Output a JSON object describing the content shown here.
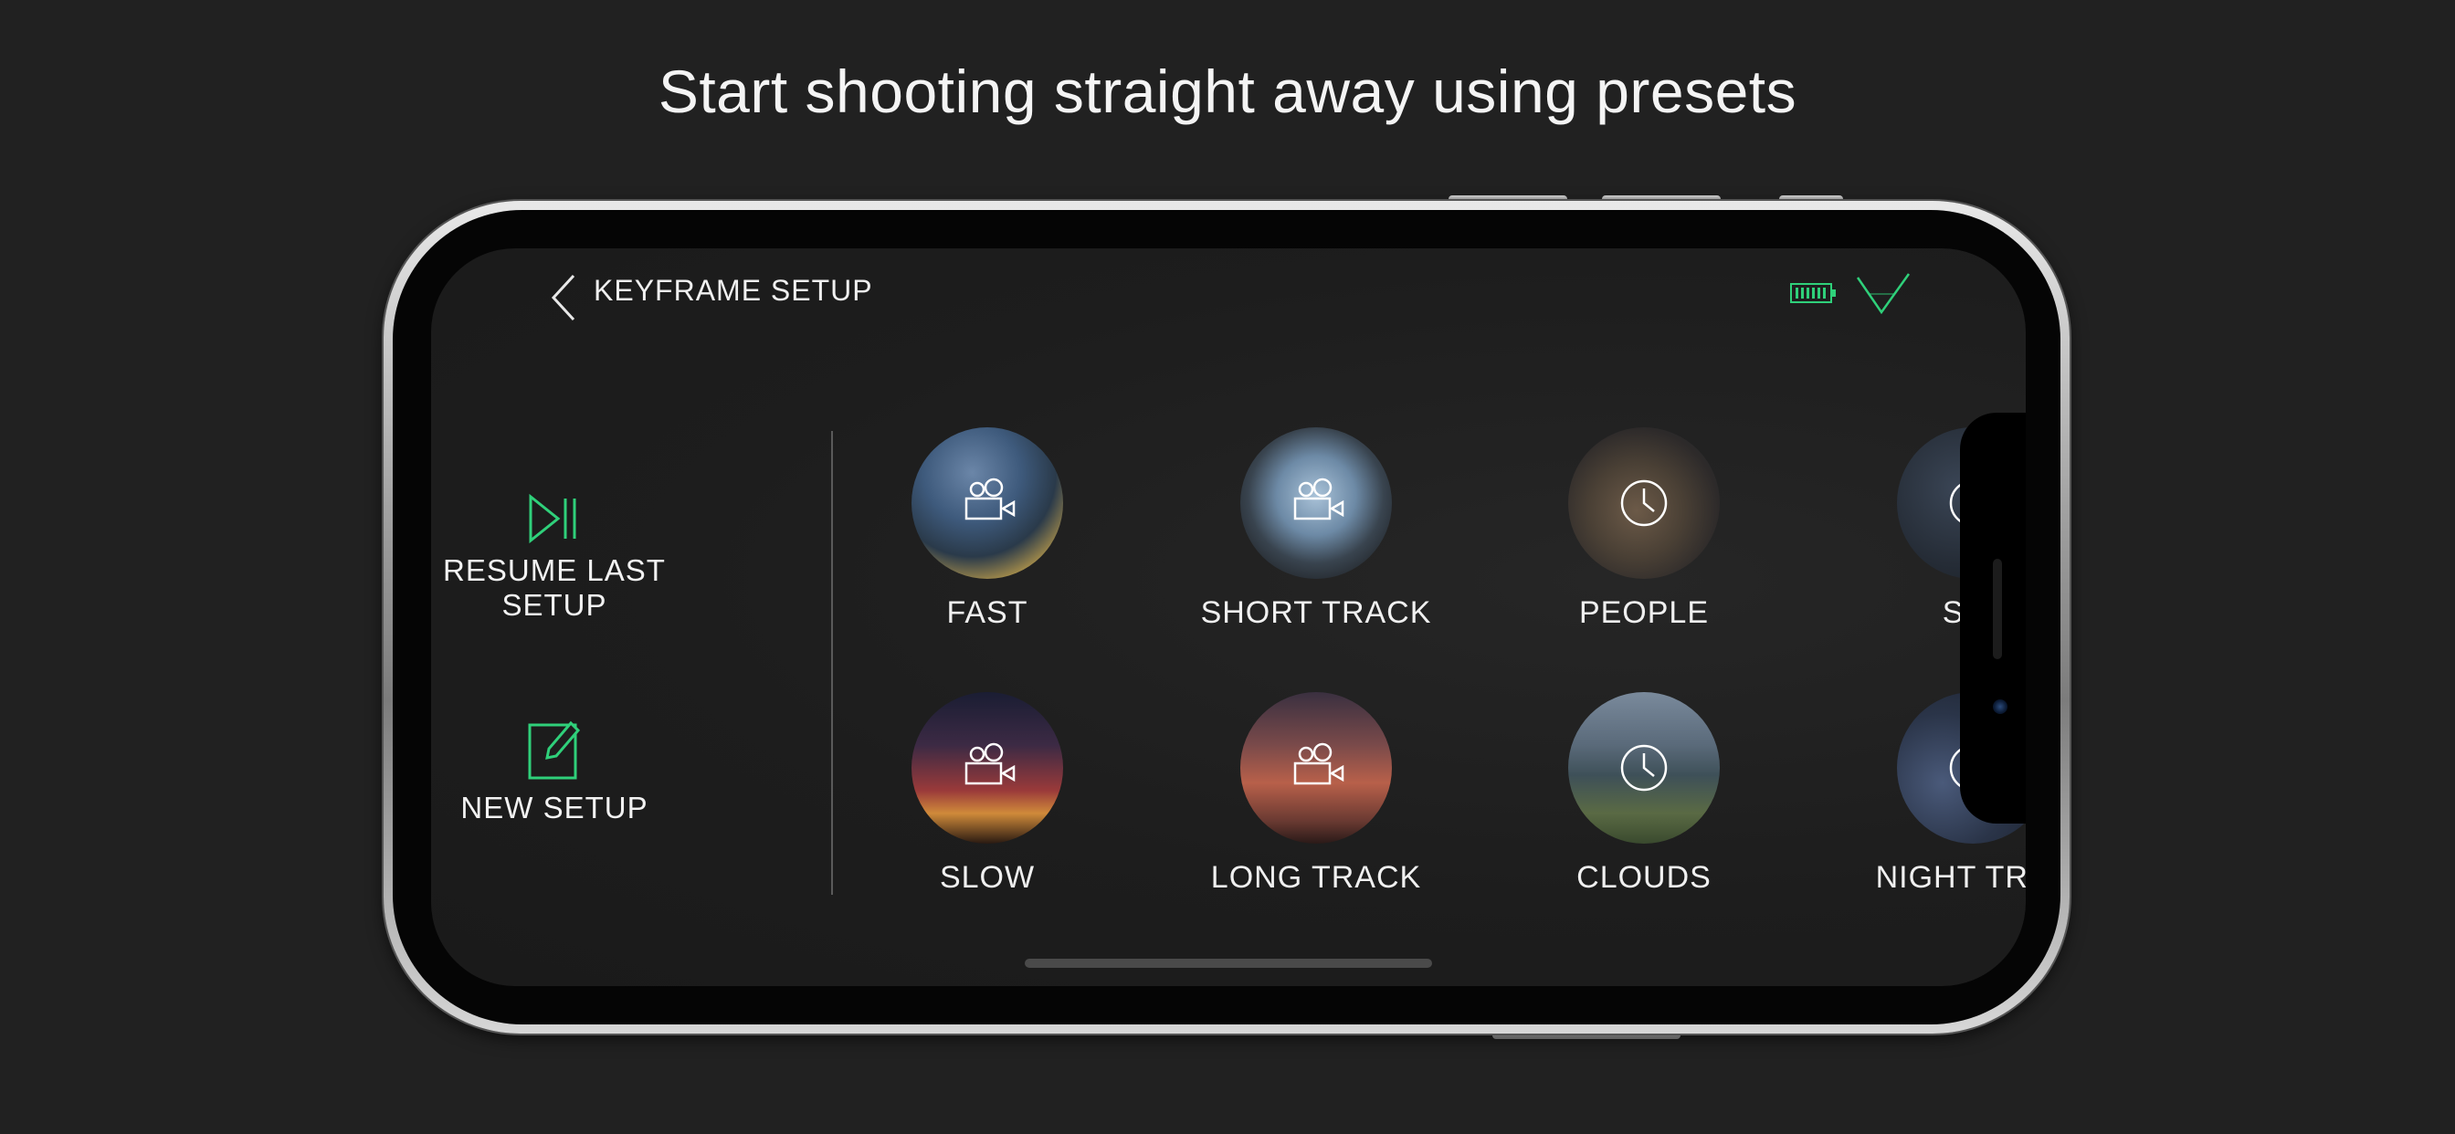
{
  "headline": "Start shooting straight away using presets",
  "topbar": {
    "title": "KEYFRAME SETUP"
  },
  "left_actions": {
    "resume_label": "RESUME LAST SETUP",
    "new_label": "NEW SETUP"
  },
  "presets": [
    {
      "label": "FAST",
      "icon": "video-camera-icon"
    },
    {
      "label": "SHORT TRACK",
      "icon": "video-camera-icon"
    },
    {
      "label": "PEOPLE",
      "icon": "clock-icon"
    },
    {
      "label": "STA",
      "icon": "clock-icon"
    },
    {
      "label": "SLOW",
      "icon": "video-camera-icon"
    },
    {
      "label": "LONG TRACK",
      "icon": "video-camera-icon"
    },
    {
      "label": "CLOUDS",
      "icon": "clock-icon"
    },
    {
      "label": "NIGHT TRAF",
      "icon": "clock-icon"
    }
  ],
  "colors": {
    "accent": "#2fd07a",
    "background": "#1e1e1e",
    "text": "#f0f0f0"
  }
}
